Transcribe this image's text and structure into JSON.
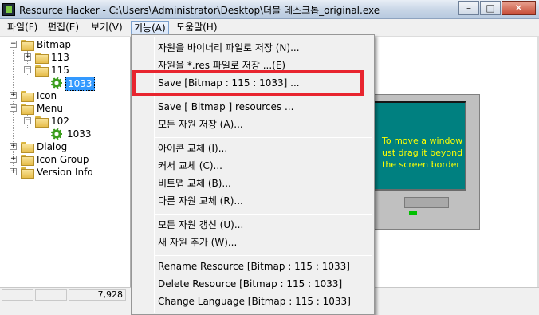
{
  "window": {
    "title": "Resource Hacker  -  C:\\Users\\Administrator\\Desktop\\더블 데스크톱_original.exe",
    "minimize": "–",
    "maximize": "□",
    "close": "✕"
  },
  "menubar": {
    "items": [
      "파일(F)",
      "편집(E)",
      "보기(V)",
      "기능(A)",
      "도움말(H)"
    ]
  },
  "tree": {
    "bitmap": "Bitmap",
    "b113": "113",
    "b115": "115",
    "b1033": "1033",
    "icon": "Icon",
    "menu": "Menu",
    "m102": "102",
    "m1033": "1033",
    "dialog": "Dialog",
    "icon_group": "Icon Group",
    "version_info": "Version Info"
  },
  "status": {
    "left": "7,928"
  },
  "preview": {
    "text": "To move a window ust drag it beyond the screen border"
  },
  "dropdown": {
    "items": [
      "자원을 바이너리 파일로 저장 (N)...",
      "자원을 *.res 파일로 저장 ...(E)",
      "Save [Bitmap : 115 : 1033] ...",
      "Save [ Bitmap ] resources ...",
      "모든 자원 저장 (A)...",
      "아이콘 교체 (I)...",
      "커서 교체 (C)...",
      "비트맵 교체 (B)...",
      "다른 자원 교체 (R)...",
      "모든 자원 갱신 (U)...",
      "새 자원 추가 (W)...",
      "Rename Resource [Bitmap : 115 : 1033]",
      "Delete Resource [Bitmap : 115 : 1033]",
      "Change Language [Bitmap : 115 : 1033]"
    ]
  },
  "colors": {
    "highlight": "#e8252f",
    "selection": "#3399ff",
    "screen": "#008080",
    "screen_text": "#ffff00"
  }
}
